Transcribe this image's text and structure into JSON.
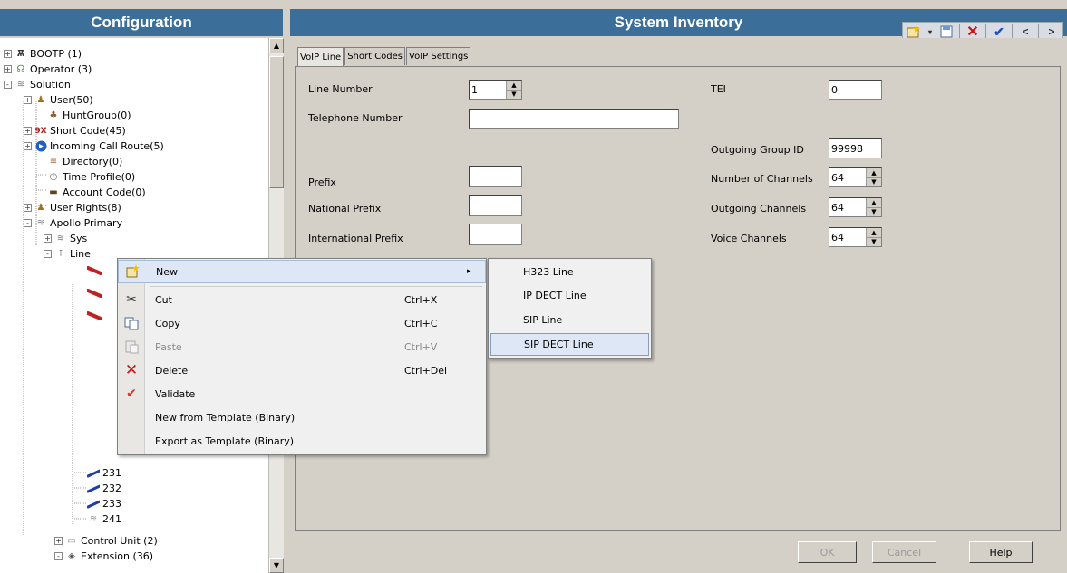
{
  "left_panel": {
    "title": "Configuration"
  },
  "right_panel": {
    "title": "System Inventory"
  },
  "toolbar": {
    "icons": [
      "new-icon",
      "dropdown-icon",
      "save-icon",
      "delete-icon",
      "validate-icon",
      "prev-icon",
      "next-icon"
    ],
    "prev_label": "<",
    "next_label": ">"
  },
  "tree": {
    "items": [
      {
        "label": "BOOTP (1)",
        "icon": "bootp-icon",
        "expander": "+"
      },
      {
        "label": "Operator (3)",
        "icon": "operator-icon",
        "expander": "+"
      },
      {
        "label": "Solution",
        "icon": "solution-icon",
        "expander": "-"
      },
      {
        "label": "User(50)",
        "icon": "user-icon",
        "expander": "+"
      },
      {
        "label": "HuntGroup(0)",
        "icon": "huntgroup-icon",
        "expander": ""
      },
      {
        "label": "Short Code(45)",
        "icon": "shortcode-icon",
        "expander": "+"
      },
      {
        "label": "Incoming Call Route(5)",
        "icon": "incoming-call-icon",
        "expander": "+"
      },
      {
        "label": "Directory(0)",
        "icon": "directory-icon",
        "expander": ""
      },
      {
        "label": "Time Profile(0)",
        "icon": "time-profile-icon",
        "expander": ""
      },
      {
        "label": "Account Code(0)",
        "icon": "account-code-icon",
        "expander": ""
      },
      {
        "label": "User Rights(8)",
        "icon": "user-rights-icon",
        "expander": "+"
      },
      {
        "label": "Apollo Primary",
        "icon": "system-icon",
        "expander": "-"
      },
      {
        "label": "Sys",
        "icon": "system-icon",
        "expander": "+"
      },
      {
        "label": "Line",
        "icon": "line-icon",
        "expander": "-"
      },
      {
        "label": "231",
        "icon": "line-icon",
        "expander": ""
      },
      {
        "label": "232",
        "icon": "line-icon",
        "expander": ""
      },
      {
        "label": "233",
        "icon": "line-icon",
        "expander": ""
      },
      {
        "label": "241",
        "icon": "line-icon",
        "expander": ""
      },
      {
        "label": "Control Unit (2)",
        "icon": "control-unit-icon",
        "expander": "+"
      },
      {
        "label": "Extension (36)",
        "icon": "extension-icon",
        "expander": "-"
      }
    ]
  },
  "tabs": [
    {
      "label": "VoIP Line"
    },
    {
      "label": "Short Codes"
    },
    {
      "label": "VoIP Settings"
    }
  ],
  "form": {
    "line_number": {
      "label": "Line Number",
      "value": "1"
    },
    "telephone_number": {
      "label": "Telephone Number",
      "value": ""
    },
    "prefix": {
      "label": "Prefix",
      "value": ""
    },
    "national_prefix": {
      "label": "National Prefix",
      "value": ""
    },
    "international_prefix": {
      "label": "International Prefix",
      "value": ""
    },
    "tei": {
      "label": "TEI",
      "value": "0"
    },
    "outgoing_group_id": {
      "label": "Outgoing Group ID",
      "value": "99998"
    },
    "number_of_channels": {
      "label": "Number of Channels",
      "value": "64"
    },
    "outgoing_channels": {
      "label": "Outgoing Channels",
      "value": "64"
    },
    "voice_channels": {
      "label": "Voice Channels",
      "value": "64"
    }
  },
  "buttons": {
    "ok": "OK",
    "cancel": "Cancel",
    "help": "Help"
  },
  "context_menu": {
    "items": [
      {
        "label": "New",
        "shortcut": "",
        "icon": "new-icon"
      },
      {
        "label": "Cut",
        "shortcut": "Ctrl+X",
        "icon": "cut-icon"
      },
      {
        "label": "Copy",
        "shortcut": "Ctrl+C",
        "icon": "copy-icon"
      },
      {
        "label": "Paste",
        "shortcut": "Ctrl+V",
        "icon": "paste-icon"
      },
      {
        "label": "Delete",
        "shortcut": "Ctrl+Del",
        "icon": "delete-icon"
      },
      {
        "label": "Validate",
        "shortcut": "",
        "icon": "validate-icon"
      },
      {
        "label": "New from Template (Binary)",
        "shortcut": "",
        "icon": ""
      },
      {
        "label": "Export as Template (Binary)",
        "shortcut": "",
        "icon": ""
      }
    ],
    "submenu_arrow": "▸"
  },
  "submenu": {
    "items": [
      {
        "label": "H323 Line"
      },
      {
        "label": "IP DECT Line"
      },
      {
        "label": "SIP Line"
      },
      {
        "label": "SIP DECT Line"
      }
    ]
  }
}
